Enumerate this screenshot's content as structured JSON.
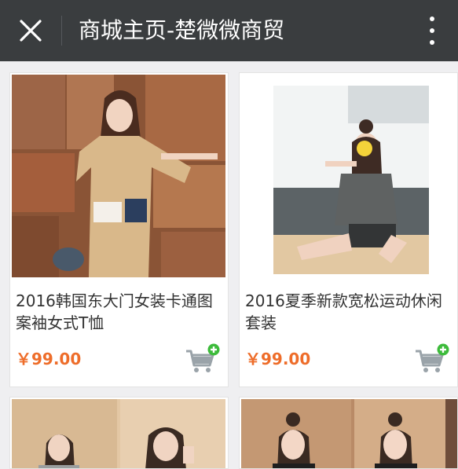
{
  "header": {
    "title": "商城主页-楚微微商贸",
    "close_icon": "close-icon",
    "more_icon": "more-vertical-icon"
  },
  "products": [
    {
      "name": "2016韩国东大门女装卡通图案袖女式T恤",
      "price": "￥99.00",
      "image": "product-photo-woman-beige-cartoon-tee",
      "cart_icon": "add-to-cart-icon"
    },
    {
      "name": "2016夏季新款宽松运动休闲套装",
      "price": "￥99.00",
      "image": "product-photo-woman-grey-sport-set",
      "cart_icon": "add-to-cart-icon"
    },
    {
      "image": "product-photo-two-women-grey-tees"
    },
    {
      "image": "product-photo-two-women-black-tees"
    }
  ],
  "colors": {
    "header_bg": "#3a3d3f",
    "price": "#ee6d2a",
    "cart_plus": "#3dbb3b",
    "cart_gray": "#9aa3a9"
  }
}
